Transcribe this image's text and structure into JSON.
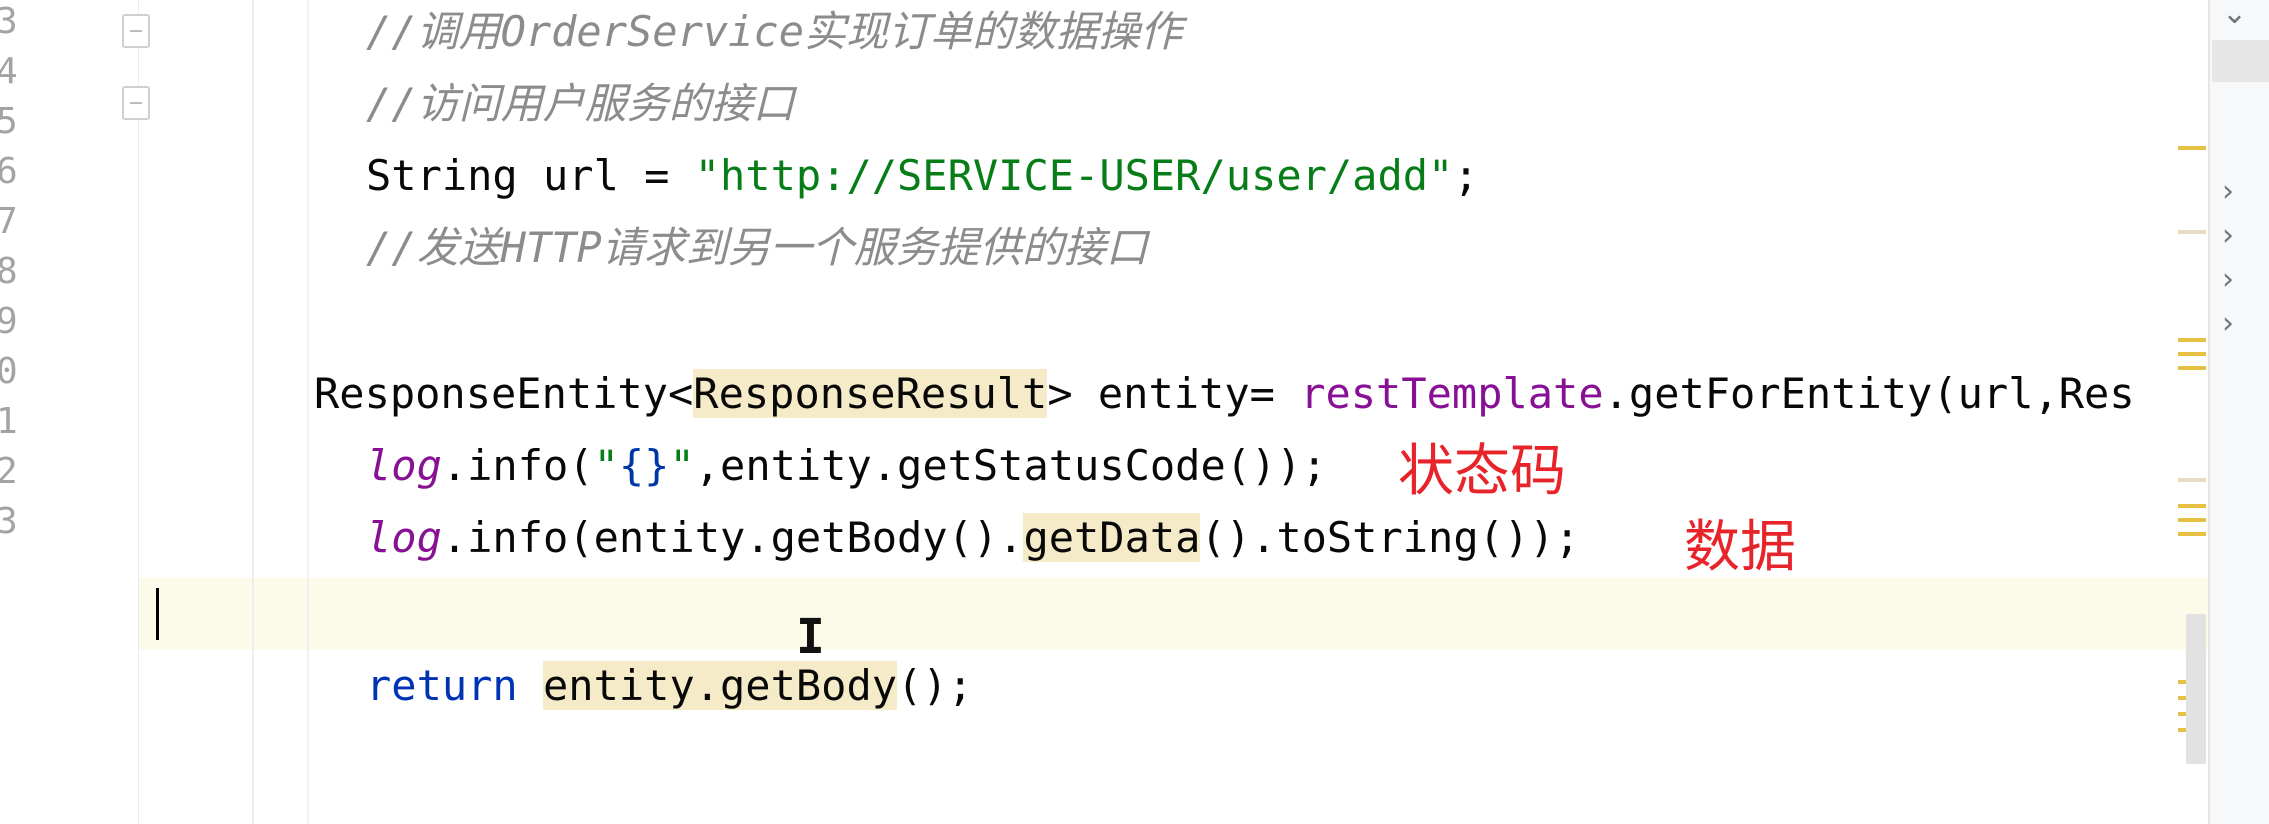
{
  "gutter": {
    "line_numbers": [
      "3",
      "4",
      "5",
      "6",
      "7",
      "8",
      "9",
      "0",
      "1",
      "2",
      "3"
    ]
  },
  "code": {
    "comment_order_service": "//调用OrderService实现订单的数据操作",
    "comment_user_api": "//访问用户服务的接口",
    "url_decl_prefix": "String url = ",
    "url_string": "\"http://SERVICE-USER/user/add\"",
    "url_decl_suffix": ";",
    "comment_http_request": "//发送HTTP请求到另一个服务提供的接口",
    "entity_type": "ResponseEntity<",
    "entity_generic": "ResponseResult",
    "entity_decl": "> entity= ",
    "rest_template": "restTemplate",
    "get_for_entity": ".getForEntity(url,Res",
    "log_1": "log",
    "log_1_call": ".info(",
    "log_1_quote_open": "\"",
    "log_1_braces": "{}",
    "log_1_quote_close": "\"",
    "log_1_rest": ",entity.getStatusCode());",
    "log_2": "log",
    "log_2_call": ".info(entity.getBody().",
    "log_2_getdata": "getData",
    "log_2_rest": "().toString());",
    "return_kw": "return",
    "return_expr": "entity.getBody",
    "return_rest": "();"
  },
  "annotations": {
    "status_code": "状态码",
    "data": "数据"
  },
  "colors": {
    "comment": "#8c8c8c",
    "string": "#067d17",
    "field": "#871094",
    "keyword": "#0033b3",
    "usage_highlight": "#f5ebc8",
    "current_line": "#fcfae9",
    "annotation_red": "#e8242b"
  },
  "icons": {
    "fold": "fold-icon",
    "panel_chevron": "chevron-right-icon",
    "panel_toggle": "chevron-down-icon",
    "text_cursor": "ibeam-cursor-icon"
  }
}
